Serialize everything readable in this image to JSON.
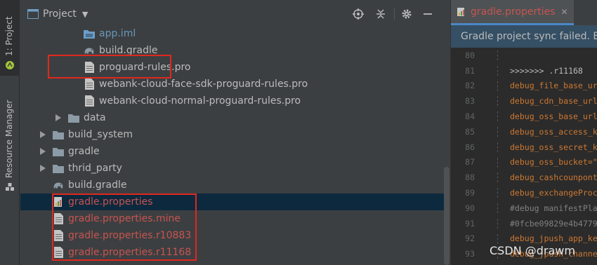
{
  "toolwindows": {
    "project_label": "1: Project",
    "resource_label": "Resource Manager"
  },
  "project_panel": {
    "title": "Project",
    "tree": [
      {
        "label": "app.iml",
        "icon": "iml-file-icon",
        "color": "blue",
        "indent": 2,
        "arrow": false
      },
      {
        "label": "build.gradle",
        "icon": "gradle-elephant-icon",
        "color": "default",
        "indent": 2,
        "arrow": false
      },
      {
        "label": "proguard-rules.pro",
        "icon": "text-file-icon",
        "color": "default",
        "indent": 2,
        "arrow": false
      },
      {
        "label": "webank-cloud-face-sdk-proguard-rules.pro",
        "icon": "text-file-icon",
        "color": "default",
        "indent": 2,
        "arrow": false
      },
      {
        "label": "webank-cloud-normal-proguard-rules.pro",
        "icon": "text-file-icon",
        "color": "default",
        "indent": 2,
        "arrow": false
      },
      {
        "label": "data",
        "icon": "folder-icon",
        "color": "default",
        "indent": 1,
        "arrow": true
      },
      {
        "label": "build_system",
        "icon": "folder-icon",
        "color": "default",
        "indent": 0,
        "arrow": true
      },
      {
        "label": "gradle",
        "icon": "folder-icon",
        "color": "default",
        "indent": 0,
        "arrow": true
      },
      {
        "label": "thrid_party",
        "icon": "folder-icon",
        "color": "default",
        "indent": 0,
        "arrow": true
      },
      {
        "label": "build.gradle",
        "icon": "gradle-elephant-icon",
        "color": "default",
        "indent": 0,
        "arrow": false
      },
      {
        "label": "gradle.properties",
        "icon": "properties-file-icon",
        "color": "red",
        "indent": 0,
        "arrow": false,
        "selected": true
      },
      {
        "label": "gradle.properties.mine",
        "icon": "text-file-icon",
        "color": "red",
        "indent": 0,
        "arrow": false
      },
      {
        "label": "gradle.properties.r10883",
        "icon": "text-file-icon",
        "color": "red",
        "indent": 0,
        "arrow": false
      },
      {
        "label": "gradle.properties.r11168",
        "icon": "text-file-icon",
        "color": "red",
        "indent": 0,
        "arrow": false
      }
    ]
  },
  "editor": {
    "tab_label": "gradle.properties",
    "banner": "Gradle project sync failed. Ba",
    "lines": [
      {
        "num": "80",
        "text": "",
        "kind": "normal"
      },
      {
        "num": "81",
        "text": ">>>>>>> .r11168",
        "kind": "conflict"
      },
      {
        "num": "82",
        "text": "debug_file_base_ur",
        "kind": "normal"
      },
      {
        "num": "83",
        "text": "debug_cdn_base_url",
        "kind": "normal"
      },
      {
        "num": "84",
        "text": "debug_oss_base_url",
        "kind": "normal"
      },
      {
        "num": "85",
        "text": "debug_oss_access_k",
        "kind": "normal"
      },
      {
        "num": "86",
        "text": "debug_oss_secret_k",
        "kind": "normal"
      },
      {
        "num": "87",
        "text": "debug_oss_bucket=\"",
        "kind": "normal"
      },
      {
        "num": "88",
        "text": "debug_cashcounpont",
        "kind": "normal"
      },
      {
        "num": "89",
        "text": "debug_exchangeProc",
        "kind": "normal"
      },
      {
        "num": "90",
        "text": "#debug manifestPla",
        "kind": "comment"
      },
      {
        "num": "91",
        "text": "#0fcbe09829e4b4779",
        "kind": "comment"
      },
      {
        "num": "92",
        "text": "debug_jpush_app_ke",
        "kind": "normal"
      },
      {
        "num": "93",
        "text": "debug_jpush_channe",
        "kind": "normal"
      }
    ]
  },
  "watermark": "CSDN @drawm"
}
